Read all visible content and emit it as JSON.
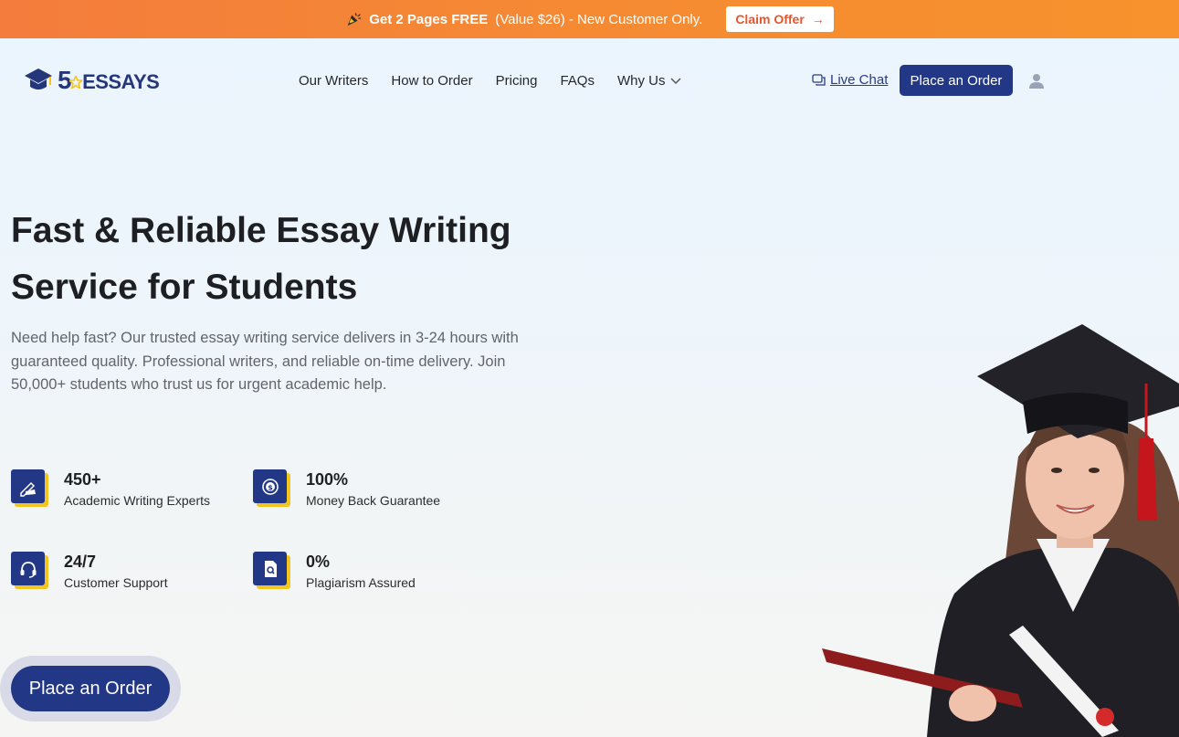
{
  "promo": {
    "bold_text": "Get 2 Pages FREE",
    "rest_text": "(Value $26) - New Customer Only.",
    "claim_label": "Claim Offer",
    "icon": "party-popper-icon"
  },
  "header": {
    "logo_digit": "5",
    "logo_word": "ESSAYS",
    "nav": [
      "Our Writers",
      "How to Order",
      "Pricing",
      "FAQs",
      "Why Us"
    ],
    "live_chat": "Live Chat",
    "place_order": "Place an Order",
    "user_icon": "user-icon"
  },
  "hero": {
    "title": "Fast & Reliable Essay Writing Service for Students",
    "description": "Need help fast? Our trusted essay writing service delivers in 3-24 hours with guaranteed quality. Professional writers, and reliable on-time delivery. Join 50,000+ students who trust us for urgent academic help.",
    "stats": [
      {
        "value": "450+",
        "label": "Academic Writing Experts",
        "icon": "writing-hand-icon"
      },
      {
        "value": "100%",
        "label": "Money Back Guarantee",
        "icon": "money-back-icon"
      },
      {
        "value": "24/7",
        "label": "Customer Support",
        "icon": "headset-icon"
      },
      {
        "value": "0%",
        "label": "Plagiarism Assured",
        "icon": "document-search-icon"
      }
    ],
    "cta": "Place an Order"
  },
  "colors": {
    "brand_blue": "#223785",
    "accent_yellow": "#f5c51f",
    "promo_orange": "#f58a33"
  }
}
